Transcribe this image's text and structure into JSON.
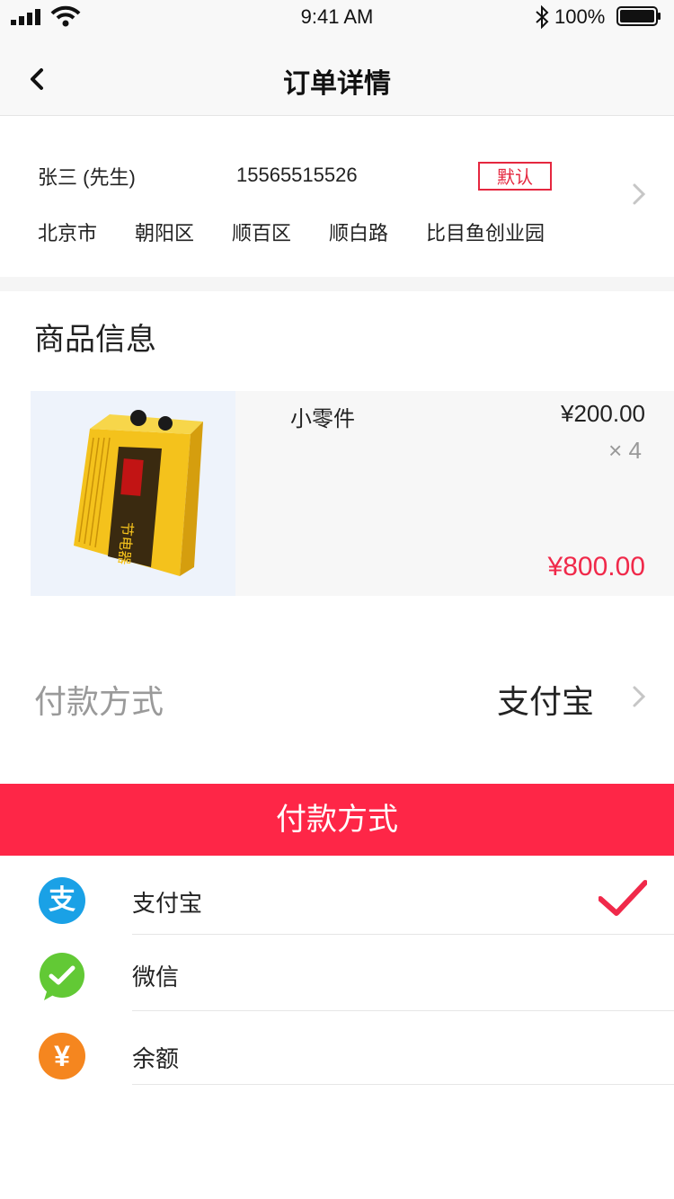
{
  "status_bar": {
    "time": "9:41 AM",
    "battery": "100%"
  },
  "nav": {
    "title": "订单详情"
  },
  "address": {
    "name": "张三 (先生)",
    "phone": "15565515526",
    "badge": "默认",
    "parts": [
      "北京市",
      "朝阳区",
      "顺百区",
      "顺白路",
      "比目鱼创业园"
    ]
  },
  "goods": {
    "section_title": "商品信息",
    "items": [
      {
        "name": "小零件",
        "price": "¥200.00",
        "quantity": "× 4",
        "total": "¥800.00",
        "image_icon": "power-saver-device-photo"
      }
    ]
  },
  "payment": {
    "label": "付款方式",
    "selected": "支付宝"
  },
  "payment_sheet": {
    "title": "付款方式",
    "options": [
      {
        "label": "支付宝",
        "icon": "alipay-icon",
        "icon_glyph": "支",
        "color": "#1aa1e6",
        "selected": true
      },
      {
        "label": "微信",
        "icon": "wechat-icon",
        "color": "#62c935",
        "selected": false
      },
      {
        "label": "余额",
        "icon": "balance-icon",
        "icon_glyph": "¥",
        "color": "#f5861f",
        "selected": false
      }
    ]
  },
  "colors": {
    "accent": "#fe2647",
    "price_red": "#f0294a"
  }
}
